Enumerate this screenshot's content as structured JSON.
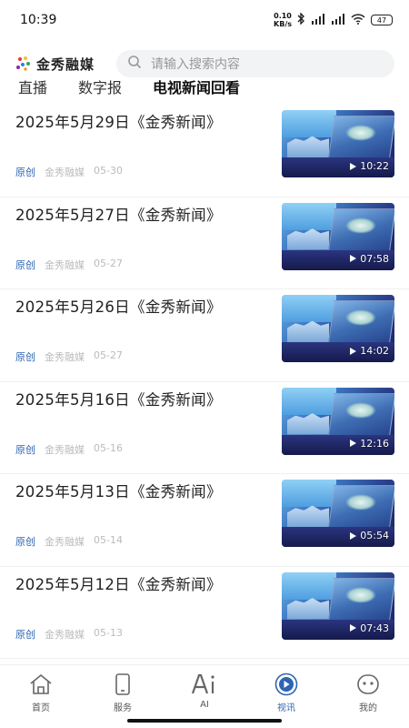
{
  "status": {
    "time": "10:39",
    "net_value": "0.10",
    "net_unit": "KB/s",
    "battery": "47"
  },
  "brand": {
    "name": "金秀融媒"
  },
  "search": {
    "placeholder": "请输入搜索内容"
  },
  "tabs": [
    {
      "label": "直播",
      "active": false
    },
    {
      "label": "数字报",
      "active": false
    },
    {
      "label": "电视新闻回看",
      "active": true
    }
  ],
  "items": [
    {
      "title": "2025年5月29日《金秀新闻》",
      "tag": "原创",
      "source": "金秀融媒",
      "date": "05-30",
      "duration": "10:22"
    },
    {
      "title": "2025年5月27日《金秀新闻》",
      "tag": "原创",
      "source": "金秀融媒",
      "date": "05-27",
      "duration": "07:58"
    },
    {
      "title": "2025年5月26日《金秀新闻》",
      "tag": "原创",
      "source": "金秀融媒",
      "date": "05-27",
      "duration": "14:02"
    },
    {
      "title": "2025年5月16日《金秀新闻》",
      "tag": "原创",
      "source": "金秀融媒",
      "date": "05-16",
      "duration": "12:16"
    },
    {
      "title": "2025年5月13日《金秀新闻》",
      "tag": "原创",
      "source": "金秀融媒",
      "date": "05-14",
      "duration": "05:54"
    },
    {
      "title": "2025年5月12日《金秀新闻》",
      "tag": "原创",
      "source": "金秀融媒",
      "date": "05-13",
      "duration": "07:43"
    }
  ],
  "nav": [
    {
      "label": "首页",
      "icon": "home-icon"
    },
    {
      "label": "服务",
      "icon": "phone-icon"
    },
    {
      "label": "AI",
      "icon": "ai-icon"
    },
    {
      "label": "视讯",
      "icon": "video-icon",
      "active": true
    },
    {
      "label": "我的",
      "icon": "profile-icon"
    }
  ],
  "colors": {
    "accent": "#2d64b3",
    "meta": "#bbbbbb"
  }
}
